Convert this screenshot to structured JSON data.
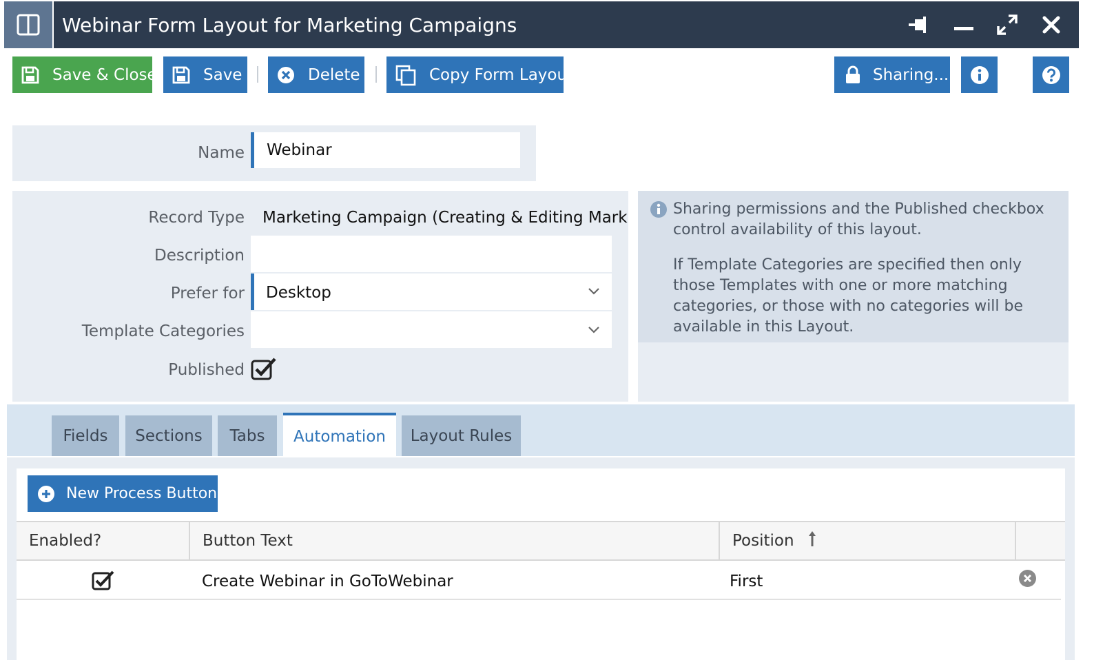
{
  "window": {
    "title": "Webinar Form Layout for Marketing Campaigns",
    "icons": [
      "layout-icon",
      "pin-icon",
      "minimize-icon",
      "expand-icon",
      "close-icon"
    ]
  },
  "toolbar": {
    "save_close": "Save & Close",
    "save": "Save",
    "delete": "Delete",
    "copy": "Copy Form Layout",
    "sharing": "Sharing..."
  },
  "form": {
    "name_label": "Name",
    "name_value": "Webinar",
    "record_type_label": "Record Type",
    "record_type_value": "Marketing Campaign (Creating & Editing Mark",
    "description_label": "Description",
    "description_value": "",
    "prefer_for_label": "Prefer for",
    "prefer_for_value": "Desktop",
    "template_categories_label": "Template Categories",
    "template_categories_value": "",
    "published_label": "Published",
    "published_checked": true
  },
  "info": {
    "p1": "Sharing permissions and the Published checkbox control availability of this layout.",
    "p2": "If Template Categories are specified then only those Templates with one or more matching categories, or those with no categories will be available in this Layout."
  },
  "tabs": [
    "Fields",
    "Sections",
    "Tabs",
    "Automation",
    "Layout Rules"
  ],
  "active_tab": "Automation",
  "automation": {
    "new_button": "New Process Button",
    "columns": [
      "Enabled?",
      "Button Text",
      "Position"
    ],
    "rows": [
      {
        "enabled": true,
        "button_text": "Create Webinar in GoToWebinar",
        "position": "First"
      }
    ]
  },
  "colors": {
    "title_bar": "#2d3b4e",
    "primary_blue": "#2f74b8",
    "green": "#4aa54f",
    "panel": "#e8edf3"
  }
}
